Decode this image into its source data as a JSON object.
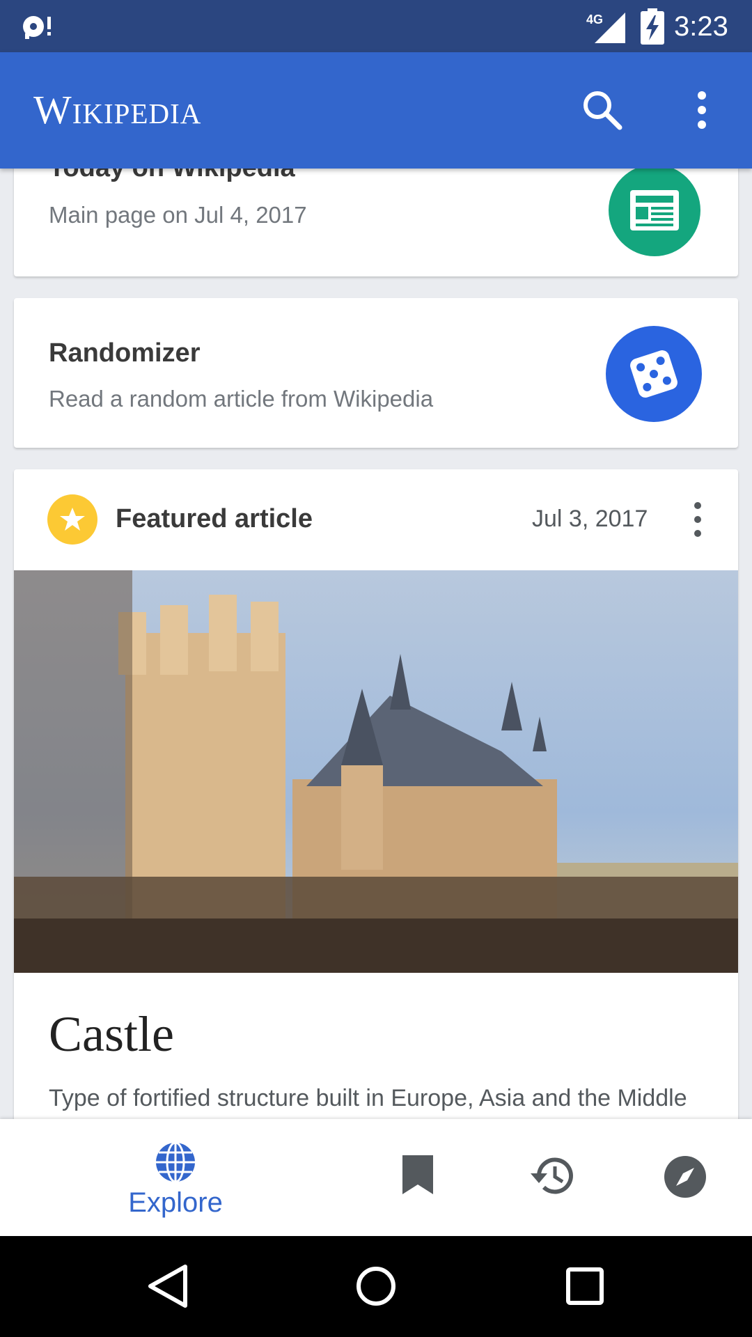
{
  "status_bar": {
    "network": "4G",
    "time": "3:23"
  },
  "app_bar": {
    "logo": "Wikipedia",
    "icons": [
      "search-icon",
      "more-vert-icon"
    ]
  },
  "cards": {
    "today": {
      "title": "Today on Wikipedia",
      "subtitle": "Main page on Jul 4, 2017",
      "icon": "newspaper-icon"
    },
    "randomizer": {
      "title": "Randomizer",
      "subtitle": "Read a random article from Wikipedia",
      "icon": "dice-icon"
    },
    "featured": {
      "header": "Featured article",
      "date": "Jul 3, 2017",
      "article_title": "Castle",
      "article_description": "Type of fortified structure built in Europe, Asia and the Middle East during the Middle Ages by nobility"
    }
  },
  "bottom_nav": {
    "explore_label": "Explore",
    "items": [
      "explore-icon",
      "bookmark-icon",
      "history-icon",
      "nearby-icon"
    ]
  },
  "colors": {
    "accent": "#3366cc",
    "today_fab": "#14a67e",
    "random_fab": "#2a64e0",
    "featured_icon": "#fcc934"
  }
}
